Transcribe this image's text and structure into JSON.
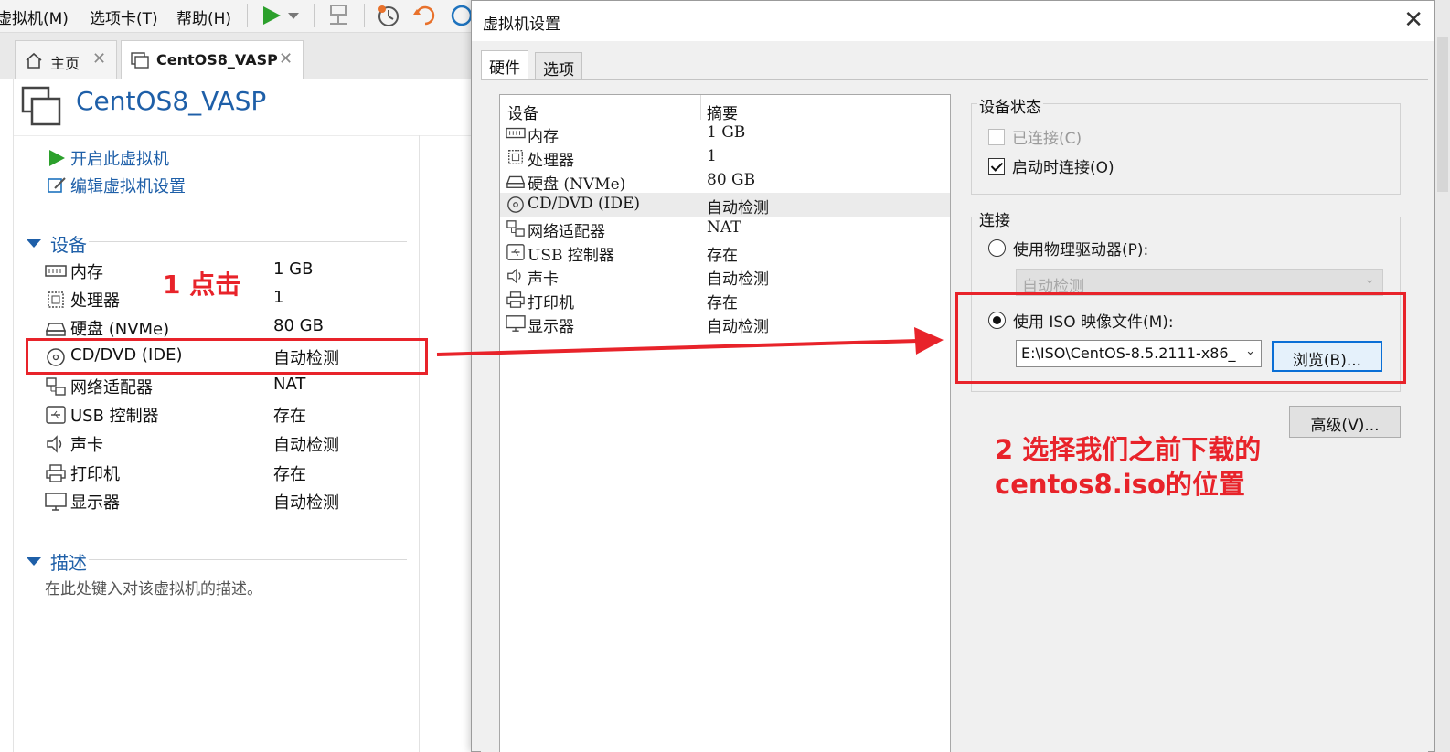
{
  "menubar": {
    "items": [
      "虚拟机(M)",
      "选项卡(T)",
      "帮助(H)"
    ]
  },
  "tabs": [
    {
      "label": "主页"
    },
    {
      "label": "CentOS8_VASP"
    }
  ],
  "vm": {
    "title": "CentOS8_VASP",
    "actions": [
      "开启此虚拟机",
      "编辑虚拟机设置"
    ],
    "devices_heading": "设备",
    "devices": [
      {
        "name": "内存",
        "value": "1 GB",
        "icon": "memory-icon"
      },
      {
        "name": "处理器",
        "value": "1",
        "icon": "cpu-icon"
      },
      {
        "name": "硬盘 (NVMe)",
        "value": "80 GB",
        "icon": "disk-icon"
      },
      {
        "name": "CD/DVD (IDE)",
        "value": "自动检测",
        "icon": "cd-icon"
      },
      {
        "name": "网络适配器",
        "value": "NAT",
        "icon": "network-icon"
      },
      {
        "name": "USB 控制器",
        "value": "存在",
        "icon": "usb-icon"
      },
      {
        "name": "声卡",
        "value": "自动检测",
        "icon": "speaker-icon"
      },
      {
        "name": "打印机",
        "value": "存在",
        "icon": "printer-icon"
      },
      {
        "name": "显示器",
        "value": "自动检测",
        "icon": "monitor-icon"
      }
    ],
    "description_heading": "描述",
    "description_placeholder": "在此处键入对该虚拟机的描述。"
  },
  "dialog": {
    "title": "虚拟机设置",
    "tabs": [
      "硬件",
      "选项"
    ],
    "hardware": {
      "col_device": "设备",
      "col_summary": "摘要",
      "rows": [
        {
          "name": "内存",
          "value": "1 GB"
        },
        {
          "name": "处理器",
          "value": "1"
        },
        {
          "name": "硬盘 (NVMe)",
          "value": "80 GB"
        },
        {
          "name": "CD/DVD (IDE)",
          "value": "自动检测",
          "selected": true
        },
        {
          "name": "网络适配器",
          "value": "NAT"
        },
        {
          "name": "USB 控制器",
          "value": "存在"
        },
        {
          "name": "声卡",
          "value": "自动检测"
        },
        {
          "name": "打印机",
          "value": "存在"
        },
        {
          "name": "显示器",
          "value": "自动检测"
        }
      ]
    },
    "device_status": {
      "label": "设备状态",
      "connected": {
        "label": "已连接(C)",
        "checked": false,
        "disabled": true
      },
      "connect_at_power_on": {
        "label": "启动时连接(O)",
        "checked": true
      }
    },
    "connection": {
      "label": "连接",
      "use_physical": {
        "label": "使用物理驱动器(P):",
        "selected": false
      },
      "physical_value": "自动检测",
      "use_iso": {
        "label": "使用 ISO 映像文件(M):",
        "selected": true
      },
      "iso_path": "E:\\ISO\\CentOS-8.5.2111-x86_",
      "browse_label": "浏览(B)..."
    },
    "advanced_label": "高级(V)..."
  },
  "annotations": {
    "step1": "1 点击",
    "step2_line1": "2 选择我们之前下载的",
    "step2_line2": "centos8.iso的位置",
    "color": "#e8232a"
  }
}
